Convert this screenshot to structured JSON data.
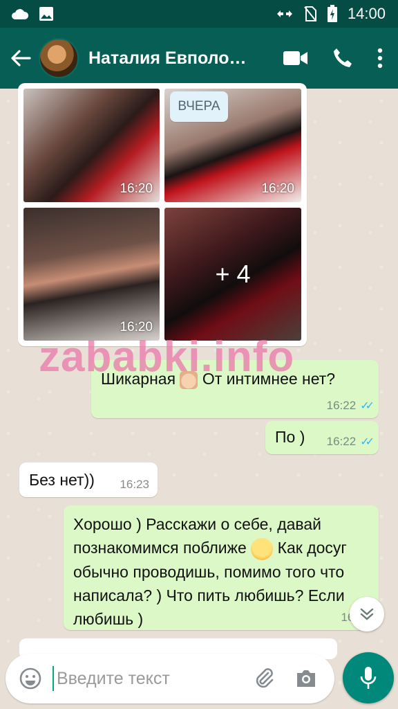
{
  "status_bar": {
    "time": "14:00",
    "icons": [
      "cloud-icon",
      "image-icon",
      "data-arrows-icon",
      "no-sim-icon",
      "battery-charging-icon"
    ]
  },
  "header": {
    "contact_name": "Наталия Евполо…",
    "icons": [
      "back-arrow-icon",
      "video-call-icon",
      "phone-icon",
      "more-vert-icon"
    ]
  },
  "media": {
    "date_chip": "ВЧЕРА",
    "thumbnails": [
      {
        "time": "16:20"
      },
      {
        "time": "16:20"
      },
      {
        "time": "16:20"
      },
      {
        "overlay": "+ 4"
      }
    ]
  },
  "watermark": "zababki.info",
  "messages": [
    {
      "direction": "out",
      "text": "Шикарная",
      "text_after_emoji": "От интимнее нет?",
      "emoji": "thumbs-up",
      "time": "16:22",
      "status": "read"
    },
    {
      "direction": "out",
      "text": "По )",
      "time": "16:22",
      "status": "read"
    },
    {
      "direction": "in",
      "text": "Без нет))",
      "time": "16:23"
    },
    {
      "direction": "out",
      "text": "Хорошо ) Расскажи о себе, давай познакомимся поближе",
      "text_after_emoji": "Как досуг обычно проводишь, помимо того что написала? ) Что пить любишь? Если любишь )",
      "emoji": "relieved-face",
      "time": "16:26"
    }
  ],
  "composer": {
    "placeholder": "Введите текст"
  },
  "colors": {
    "header": "#075e54",
    "status_bar": "#054d44",
    "outgoing_bubble": "#dcf8c6",
    "incoming_bubble": "#ffffff",
    "read_ticks": "#34b7f1",
    "mic_button": "#00897b"
  }
}
